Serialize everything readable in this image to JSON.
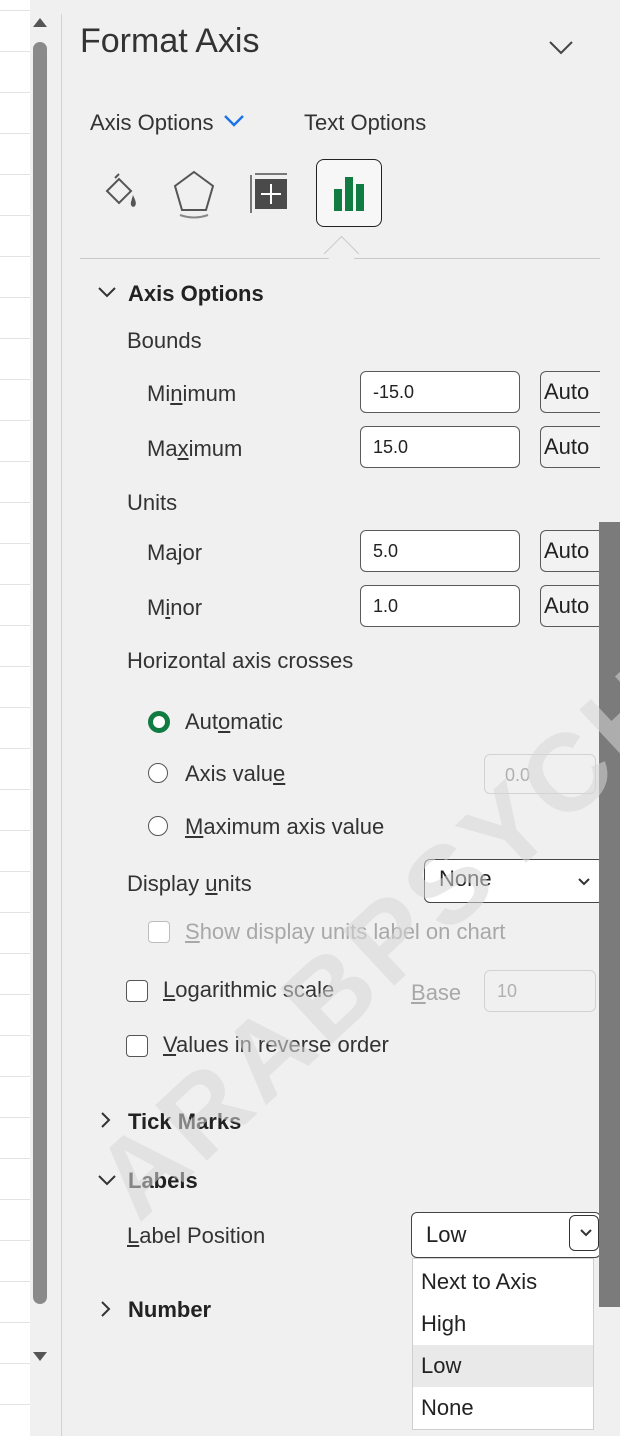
{
  "pane": {
    "title": "Format Axis",
    "tabs": {
      "axis_options": "Axis Options",
      "text_options": "Text Options"
    },
    "icon_tabs": [
      "fill-line-icon",
      "effects-icon",
      "size-properties-icon",
      "axis-options-icon"
    ]
  },
  "axis_options": {
    "heading": "Axis Options",
    "bounds_label": "Bounds",
    "minimum": {
      "label_pre": "Mi",
      "label_u": "n",
      "label_post": "imum",
      "value": "-15.0",
      "button": "Auto"
    },
    "maximum": {
      "label_pre": "Ma",
      "label_u": "x",
      "label_post": "imum",
      "value": "15.0",
      "button": "Auto"
    },
    "units_label": "Units",
    "major": {
      "label_pre": "Ma",
      "label_u": "j",
      "label_post": "or",
      "value": "5.0",
      "button": "Auto"
    },
    "minor": {
      "label_pre": "M",
      "label_u": "i",
      "label_post": "nor",
      "value": "1.0",
      "button": "Auto"
    },
    "crosses_label": "Horizontal axis crosses",
    "crosses": {
      "automatic": {
        "pre": "Aut",
        "u": "o",
        "post": "matic",
        "selected": true
      },
      "axis_value": {
        "pre": "Axis valu",
        "u": "e",
        "post": "",
        "value": "0.0"
      },
      "max_value": {
        "pre": "",
        "u": "M",
        "post": "aximum axis value"
      }
    },
    "display_units": {
      "pre": "Display ",
      "u": "u",
      "post": "nits",
      "value": "None"
    },
    "show_units_label": {
      "pre": "",
      "u": "S",
      "post": "how display units label on chart"
    },
    "log_scale": {
      "pre": "",
      "u": "L",
      "post": "ogarithmic scale",
      "base_pre": "",
      "base_u": "B",
      "base_post": "ase",
      "base_value": "10"
    },
    "reverse": {
      "pre": "",
      "u": "V",
      "post": "alues in reverse order"
    }
  },
  "tick_marks": {
    "heading": "Tick Marks"
  },
  "labels": {
    "heading": "Labels",
    "position": {
      "pre": "",
      "u": "L",
      "post": "abel Position",
      "value": "Low"
    },
    "options": [
      "Next to Axis",
      "High",
      "Low",
      "None"
    ]
  },
  "number": {
    "heading": "Number"
  },
  "watermark": "ARABPSYCH",
  "colors": {
    "accent": "#107c41",
    "chevron_blue": "#1a73e8"
  }
}
